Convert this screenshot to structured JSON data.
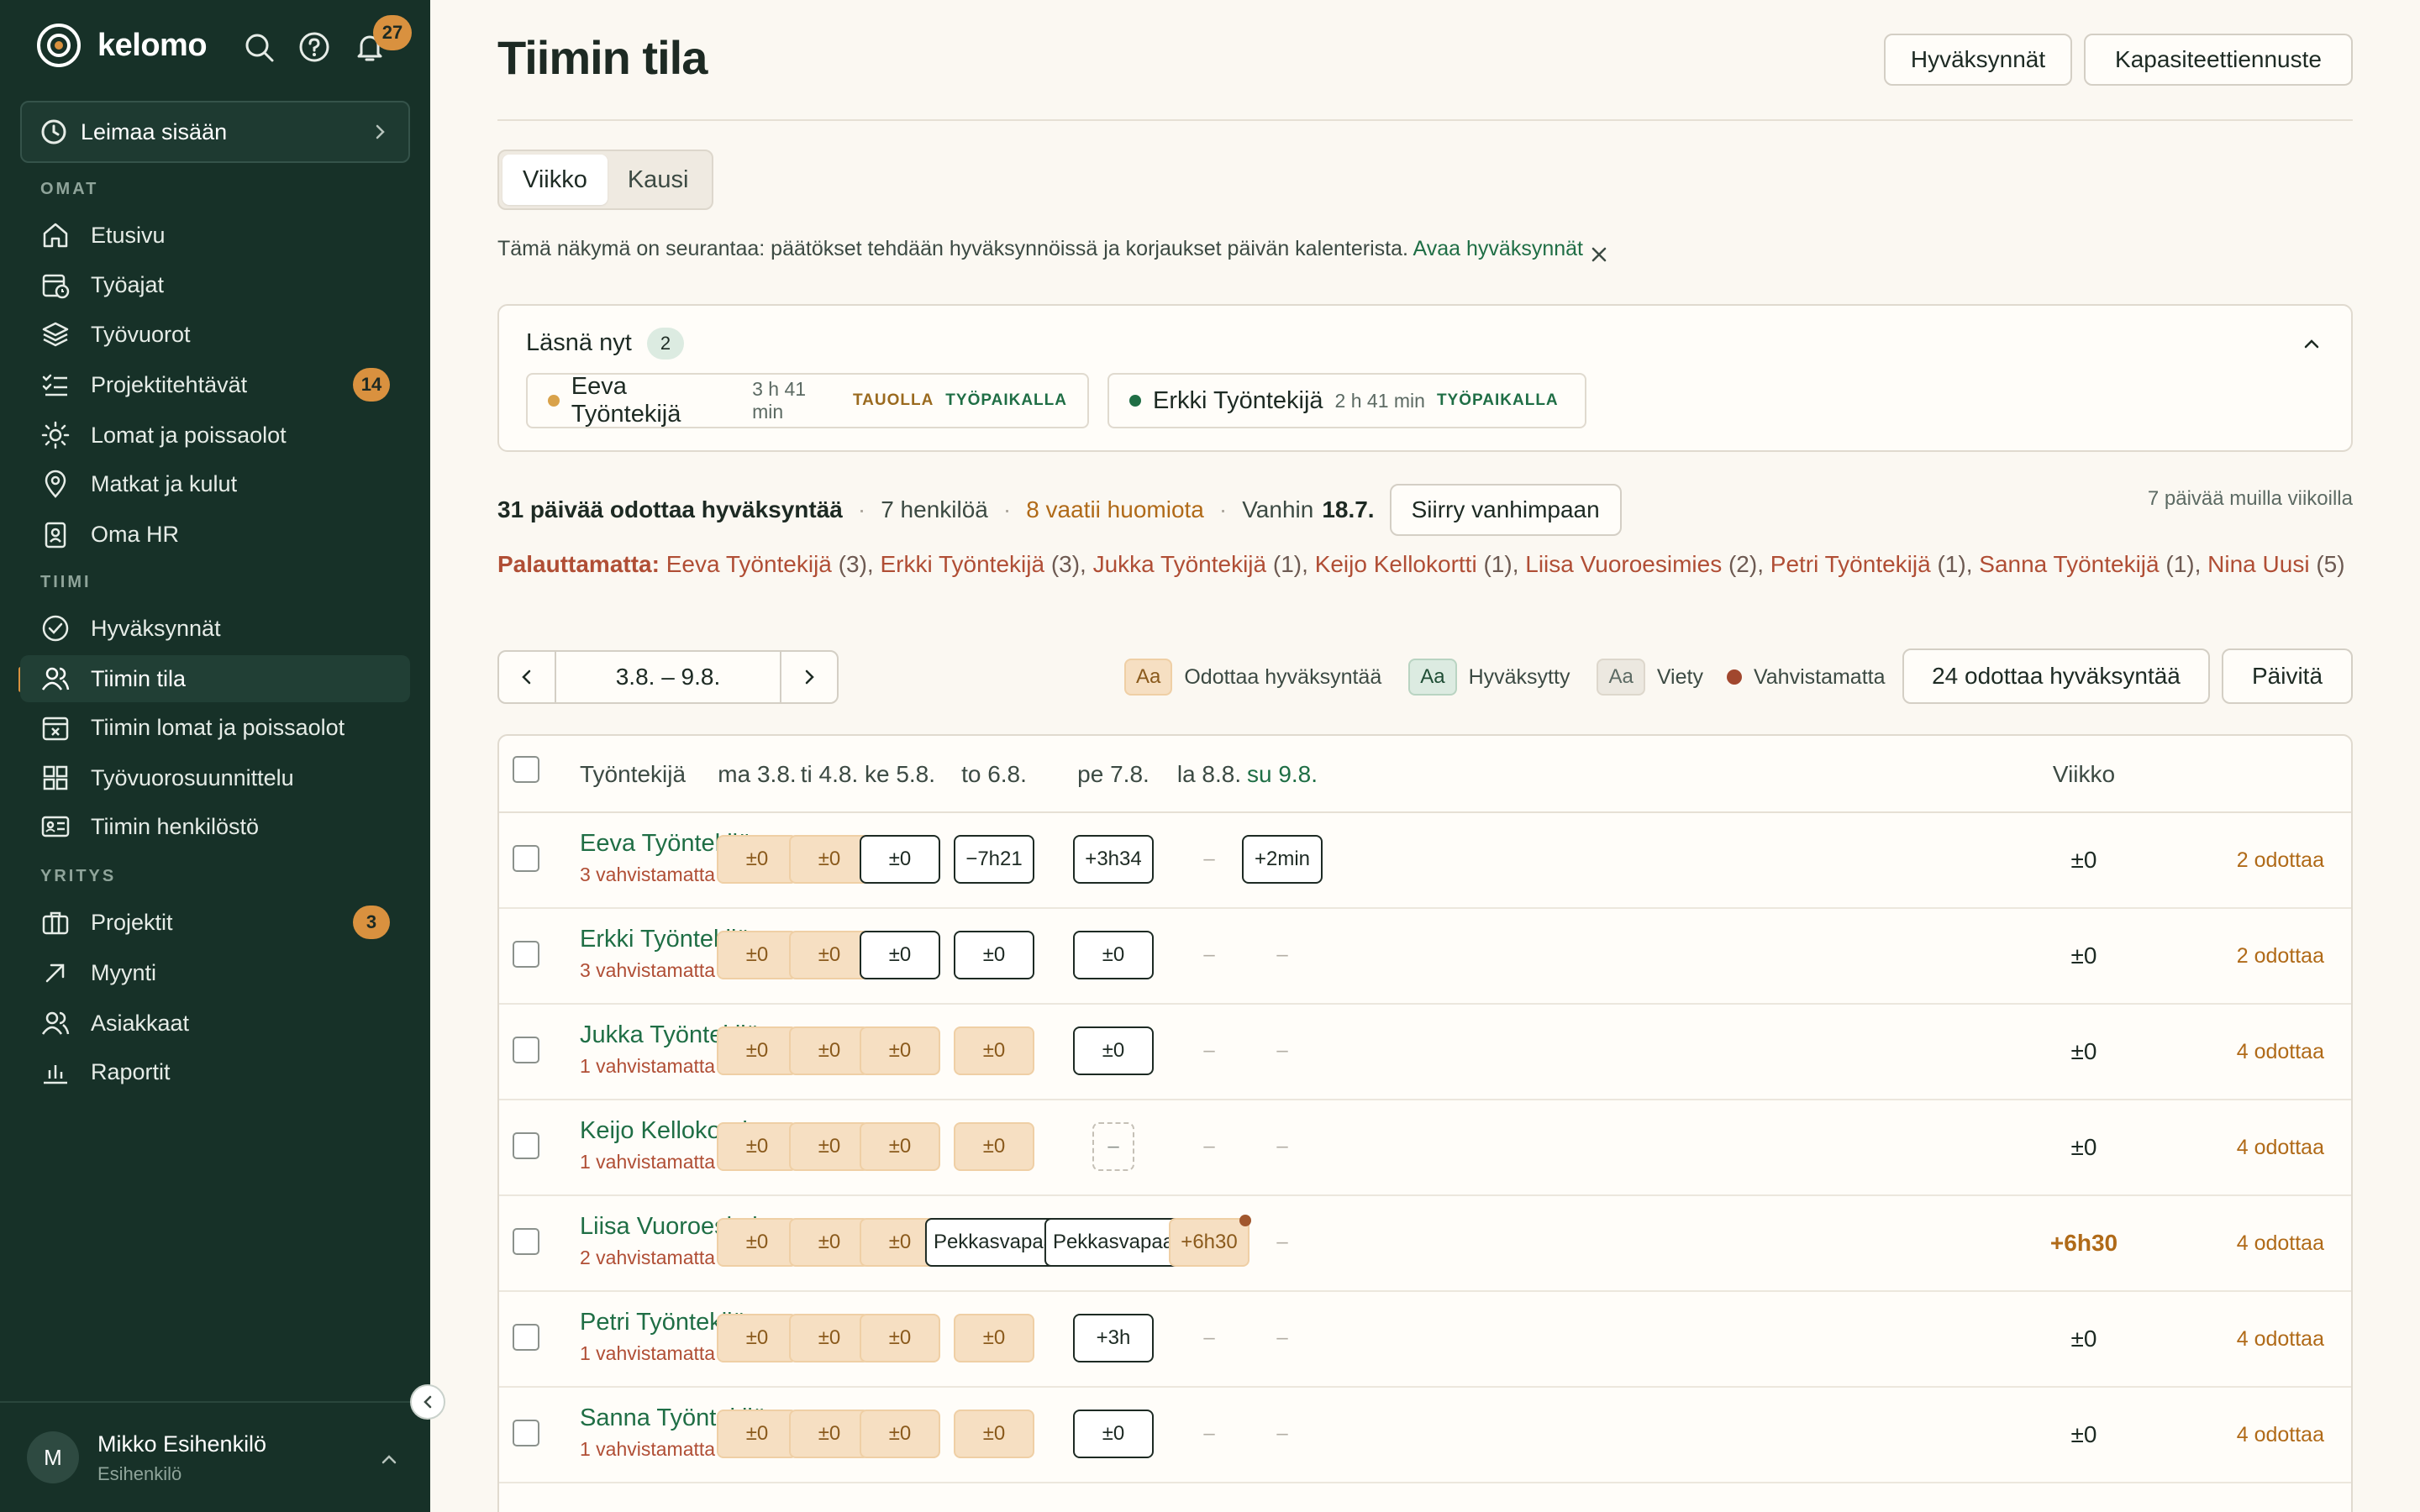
{
  "app": {
    "brand": "kelomo",
    "notification_count": "27",
    "clock_in_label": "Leimaa sisään"
  },
  "sidebar": {
    "sections": [
      {
        "label": "OMAT"
      },
      {
        "label": "TIIMI"
      },
      {
        "label": "YRITYS"
      }
    ],
    "items": [
      {
        "label": "Etusivu",
        "icon": "home-icon"
      },
      {
        "label": "Työajat",
        "icon": "calendar-clock-icon"
      },
      {
        "label": "Työvuorot",
        "icon": "layers-icon"
      },
      {
        "label": "Projektitehtävät",
        "icon": "checklist-icon",
        "badge": "14"
      },
      {
        "label": "Lomat ja poissaolot",
        "icon": "sun-icon"
      },
      {
        "label": "Matkat ja kulut",
        "icon": "map-pin-icon"
      },
      {
        "label": "Oma HR",
        "icon": "id-badge-icon"
      },
      {
        "label": "Hyväksynnät",
        "icon": "check-circle-icon"
      },
      {
        "label": "Tiimin tila",
        "icon": "users-icon",
        "active": true
      },
      {
        "label": "Tiimin lomat ja poissaolot",
        "icon": "calendar-x-icon"
      },
      {
        "label": "Työvuorosuunnittelu",
        "icon": "grid-icon"
      },
      {
        "label": "Tiimin henkilöstö",
        "icon": "id-card-icon"
      },
      {
        "label": "Projektit",
        "icon": "briefcase-icon",
        "badge": "3"
      },
      {
        "label": "Myynti",
        "icon": "arrow-up-right-icon"
      },
      {
        "label": "Asiakkaat",
        "icon": "users-icon"
      },
      {
        "label": "Raportit",
        "icon": "bar-chart-icon"
      }
    ],
    "user": {
      "initial": "M",
      "name": "Mikko Esihenkilö",
      "role": "Esihenkilö"
    }
  },
  "header": {
    "title": "Tiimin tila",
    "approvals_button": "Hyväksynnät",
    "capacity_button": "Kapasiteettiennuste"
  },
  "view_toggle": {
    "week": "Viikko",
    "period": "Kausi"
  },
  "notice": {
    "text": "Tämä näkymä on seurantaa: päätökset tehdään hyväksynnöissä ja korjaukset päivän kalenterista.",
    "link": "Avaa hyväksynnät"
  },
  "present_now": {
    "title": "Läsnä nyt",
    "count": "2",
    "people": [
      {
        "name": "Eeva Työntekijä",
        "time": "3 h 41 min",
        "tags": [
          "TAUOLLA",
          "TYÖPAIKALLA"
        ],
        "dot_color": "#d9a24a"
      },
      {
        "name": "Erkki Työntekijä",
        "time": "2 h 41 min",
        "tags": [
          "TYÖPAIKALLA"
        ],
        "dot_color": "#1f6e45"
      }
    ]
  },
  "summary": {
    "pending_days": "31 päivää odottaa hyväksyntää",
    "people": "7 henkilöä",
    "attention": "8 vaatii huomiota",
    "oldest_label": "Vanhin",
    "oldest_date": "18.7.",
    "goto_oldest": "Siirry vanhimpaan",
    "other_weeks": "7 päivää muilla viikoilla"
  },
  "unreturned": {
    "label": "Palauttamatta:",
    "people": [
      {
        "name": "Eeva Työntekijä",
        "count": "(3)"
      },
      {
        "name": "Erkki Työntekijä",
        "count": "(3)"
      },
      {
        "name": "Jukka Työntekijä",
        "count": "(1)"
      },
      {
        "name": "Keijo Kellokortti",
        "count": "(1)"
      },
      {
        "name": "Liisa Vuoroesimies",
        "count": "(2)"
      },
      {
        "name": "Petri Työntekijä",
        "count": "(1)"
      },
      {
        "name": "Sanna Työntekijä",
        "count": "(1)"
      },
      {
        "name": "Nina Uusi",
        "count": "(5)"
      }
    ]
  },
  "date_range": "3.8. – 9.8.",
  "legend": {
    "sample": "Aa",
    "pending": "Odottaa hyväksyntää",
    "approved": "Hyväksytty",
    "exported": "Viety",
    "unconfirmed": "Vahvistamatta",
    "pending_button": "24 odottaa hyväksyntää",
    "refresh_button": "Päivitä"
  },
  "table": {
    "columns": [
      "Työntekijä",
      "ma 3.8.",
      "ti 4.8.",
      "ke 5.8.",
      "to 6.8.",
      "pe 7.8.",
      "la 8.8.",
      "su 9.8.",
      "Viikko"
    ],
    "rows": [
      {
        "name": "Eeva Työntekijä",
        "sub": "3 vahvistamatta",
        "week": "±0",
        "status": "2 odottaa",
        "cells": [
          [
            "pending",
            "±0"
          ],
          [
            "pending",
            "±0"
          ],
          [
            "box",
            "±0"
          ],
          [
            "box",
            "−7h21"
          ],
          [
            "box",
            "+3h34"
          ],
          [
            "dash",
            "–"
          ],
          [
            "box",
            "+2min"
          ]
        ]
      },
      {
        "name": "Erkki Työntekijä",
        "sub": "3 vahvistamatta",
        "week": "±0",
        "status": "2 odottaa",
        "cells": [
          [
            "pending",
            "±0"
          ],
          [
            "pending",
            "±0"
          ],
          [
            "box",
            "±0"
          ],
          [
            "box",
            "±0"
          ],
          [
            "box",
            "±0"
          ],
          [
            "dash",
            "–"
          ],
          [
            "dash",
            "–"
          ]
        ]
      },
      {
        "name": "Jukka Työntekijä",
        "sub": "1 vahvistamatta",
        "week": "±0",
        "status": "4 odottaa",
        "cells": [
          [
            "pending",
            "±0"
          ],
          [
            "pending",
            "±0"
          ],
          [
            "pending",
            "±0"
          ],
          [
            "pending",
            "±0"
          ],
          [
            "box",
            "±0"
          ],
          [
            "dash",
            "–"
          ],
          [
            "dash",
            "–"
          ]
        ]
      },
      {
        "name": "Keijo Kellokortti",
        "sub": "1 vahvistamatta",
        "week": "±0",
        "status": "4 odottaa",
        "cells": [
          [
            "pending",
            "±0"
          ],
          [
            "pending",
            "±0"
          ],
          [
            "pending",
            "±0"
          ],
          [
            "pending",
            "±0"
          ],
          [
            "dashed",
            "–"
          ],
          [
            "dash",
            "–"
          ],
          [
            "dash",
            "–"
          ]
        ]
      },
      {
        "name": "Liisa Vuoroesimies",
        "sub": "2 vahvistamatta",
        "week": "+6h30",
        "status": "4 odottaa",
        "cells": [
          [
            "pending",
            "±0"
          ],
          [
            "pending",
            "±0"
          ],
          [
            "pending",
            "±0"
          ],
          [
            "box",
            "Pekkasvapaa"
          ],
          [
            "box",
            "Pekkasvapaa"
          ],
          [
            "pending-mark",
            "+6h30"
          ],
          [
            "dash",
            "–"
          ]
        ]
      },
      {
        "name": "Petri Työntekijä",
        "sub": "1 vahvistamatta",
        "week": "±0",
        "status": "4 odottaa",
        "cells": [
          [
            "pending",
            "±0"
          ],
          [
            "pending",
            "±0"
          ],
          [
            "pending",
            "±0"
          ],
          [
            "pending",
            "±0"
          ],
          [
            "box",
            "+3h"
          ],
          [
            "dash",
            "–"
          ],
          [
            "dash",
            "–"
          ]
        ]
      },
      {
        "name": "Sanna Työntekijä",
        "sub": "1 vahvistamatta",
        "week": "±0",
        "status": "4 odottaa",
        "cells": [
          [
            "pending",
            "±0"
          ],
          [
            "pending",
            "±0"
          ],
          [
            "pending",
            "±0"
          ],
          [
            "pending",
            "±0"
          ],
          [
            "box",
            "±0"
          ],
          [
            "dash",
            "–"
          ],
          [
            "dash",
            "–"
          ]
        ]
      }
    ]
  }
}
